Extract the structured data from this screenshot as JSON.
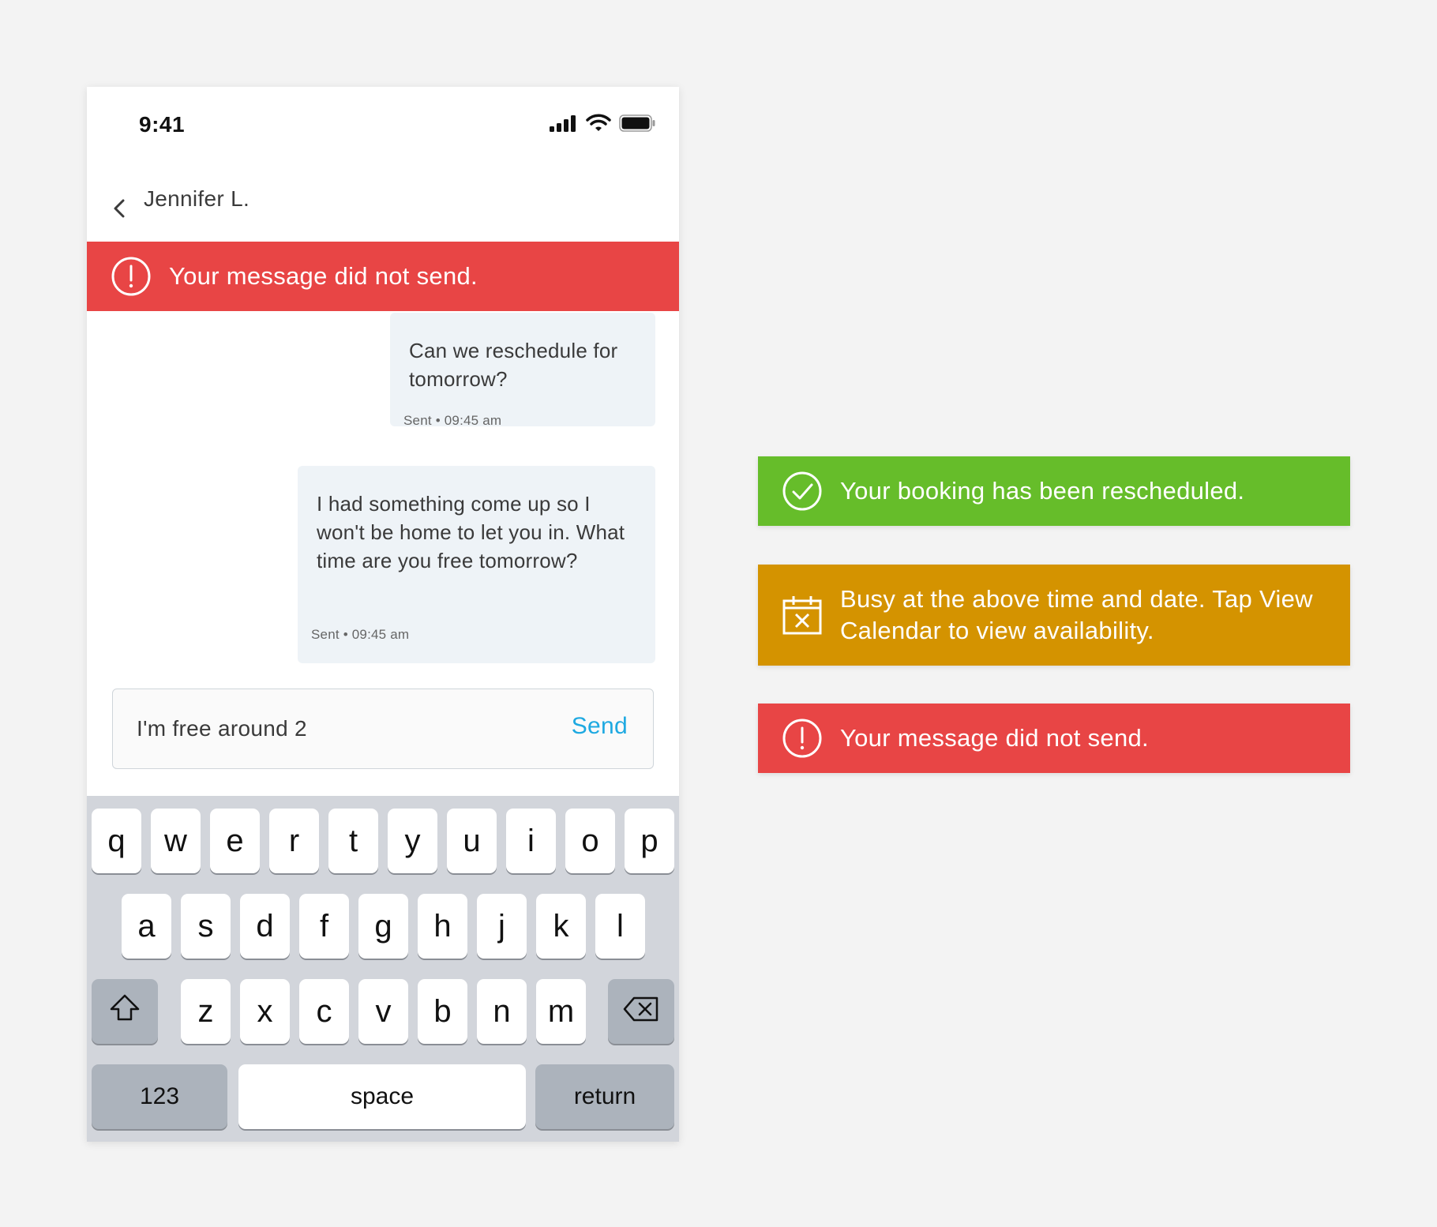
{
  "phone": {
    "status_bar": {
      "time": "9:41"
    },
    "nav": {
      "title": "Jennifer L."
    },
    "error_banner": {
      "text": "Your message did not send.",
      "icon": "exclamation-circle-icon",
      "color": "#e84545"
    },
    "messages": [
      {
        "text": "Can we reschedule for tomorrow?",
        "meta": "Sent • 09:45 am"
      },
      {
        "text": "I had something come up so I won't be home to let you in. What time are you free tomorrow?",
        "meta": "Sent • 09:45 am"
      }
    ],
    "composer": {
      "value": "I'm free around 2",
      "send_label": "Send",
      "send_color": "#1ea9e1"
    },
    "keyboard": {
      "row1": [
        "q",
        "w",
        "e",
        "r",
        "t",
        "y",
        "u",
        "i",
        "o",
        "p"
      ],
      "row2": [
        "a",
        "s",
        "d",
        "f",
        "g",
        "h",
        "j",
        "k",
        "l"
      ],
      "row3": [
        "z",
        "x",
        "c",
        "v",
        "b",
        "n",
        "m"
      ],
      "numbers_label": "123",
      "space_label": "space",
      "return_label": "return"
    }
  },
  "toasts": {
    "success": {
      "text": "Your booking has been rescheduled.",
      "icon": "check-circle-icon",
      "color": "#66bd2a"
    },
    "warning": {
      "text": "Busy at the above time and date. Tap View Calendar to view availability.",
      "icon": "calendar-x-icon",
      "color": "#d49300"
    },
    "error": {
      "text": "Your message did not send.",
      "icon": "exclamation-circle-icon",
      "color": "#e84545"
    }
  }
}
